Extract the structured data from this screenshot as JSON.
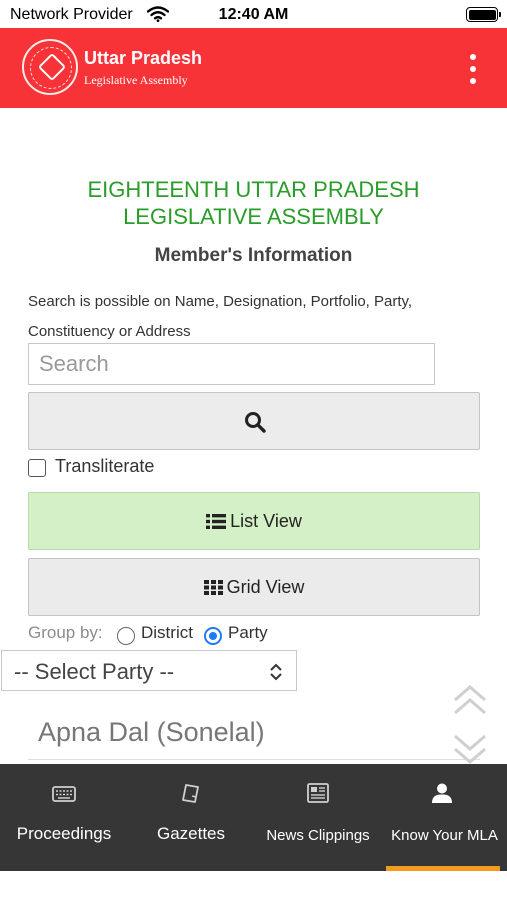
{
  "status_bar": {
    "carrier": "Network Provider",
    "time": "12:40 AM"
  },
  "header": {
    "title": "Uttar Pradesh",
    "subtitle": "Legislative Assembly",
    "brand_color": "#f73338"
  },
  "main": {
    "assembly_title_line1": "EIGHTEENTH UTTAR PRADESH",
    "assembly_title_line2": "LEGISLATIVE ASSEMBLY",
    "section_heading": "Member's Information",
    "search_help": "Search is possible on Name, Designation, Portfolio, Party, Constituency or Address",
    "search": {
      "placeholder": "Search",
      "value": ""
    },
    "search_button_icon": "search-icon",
    "transliterate": {
      "label": "Transliterate",
      "checked": false
    },
    "list_view_label": "List View",
    "grid_view_label": "Grid View",
    "group_by": {
      "label": "Group by:",
      "options": [
        "District",
        "Party"
      ],
      "selected": "Party"
    },
    "party_select": {
      "selected": "-- Select Party --"
    },
    "party_list": [
      "Apna Dal (Sonelal)"
    ],
    "accent_color": "#2a9c2a",
    "list_view_color": "#d4f0c6"
  },
  "bottom_nav": {
    "items": [
      {
        "label": "Proceedings",
        "icon": "keyboard-icon"
      },
      {
        "label": "Gazettes",
        "icon": "document-icon"
      },
      {
        "label": "News Clippings",
        "icon": "newspaper-icon"
      },
      {
        "label": "Know Your MLA",
        "icon": "person-icon"
      }
    ],
    "active": "Know Your MLA",
    "active_color": "#f39a1f"
  }
}
